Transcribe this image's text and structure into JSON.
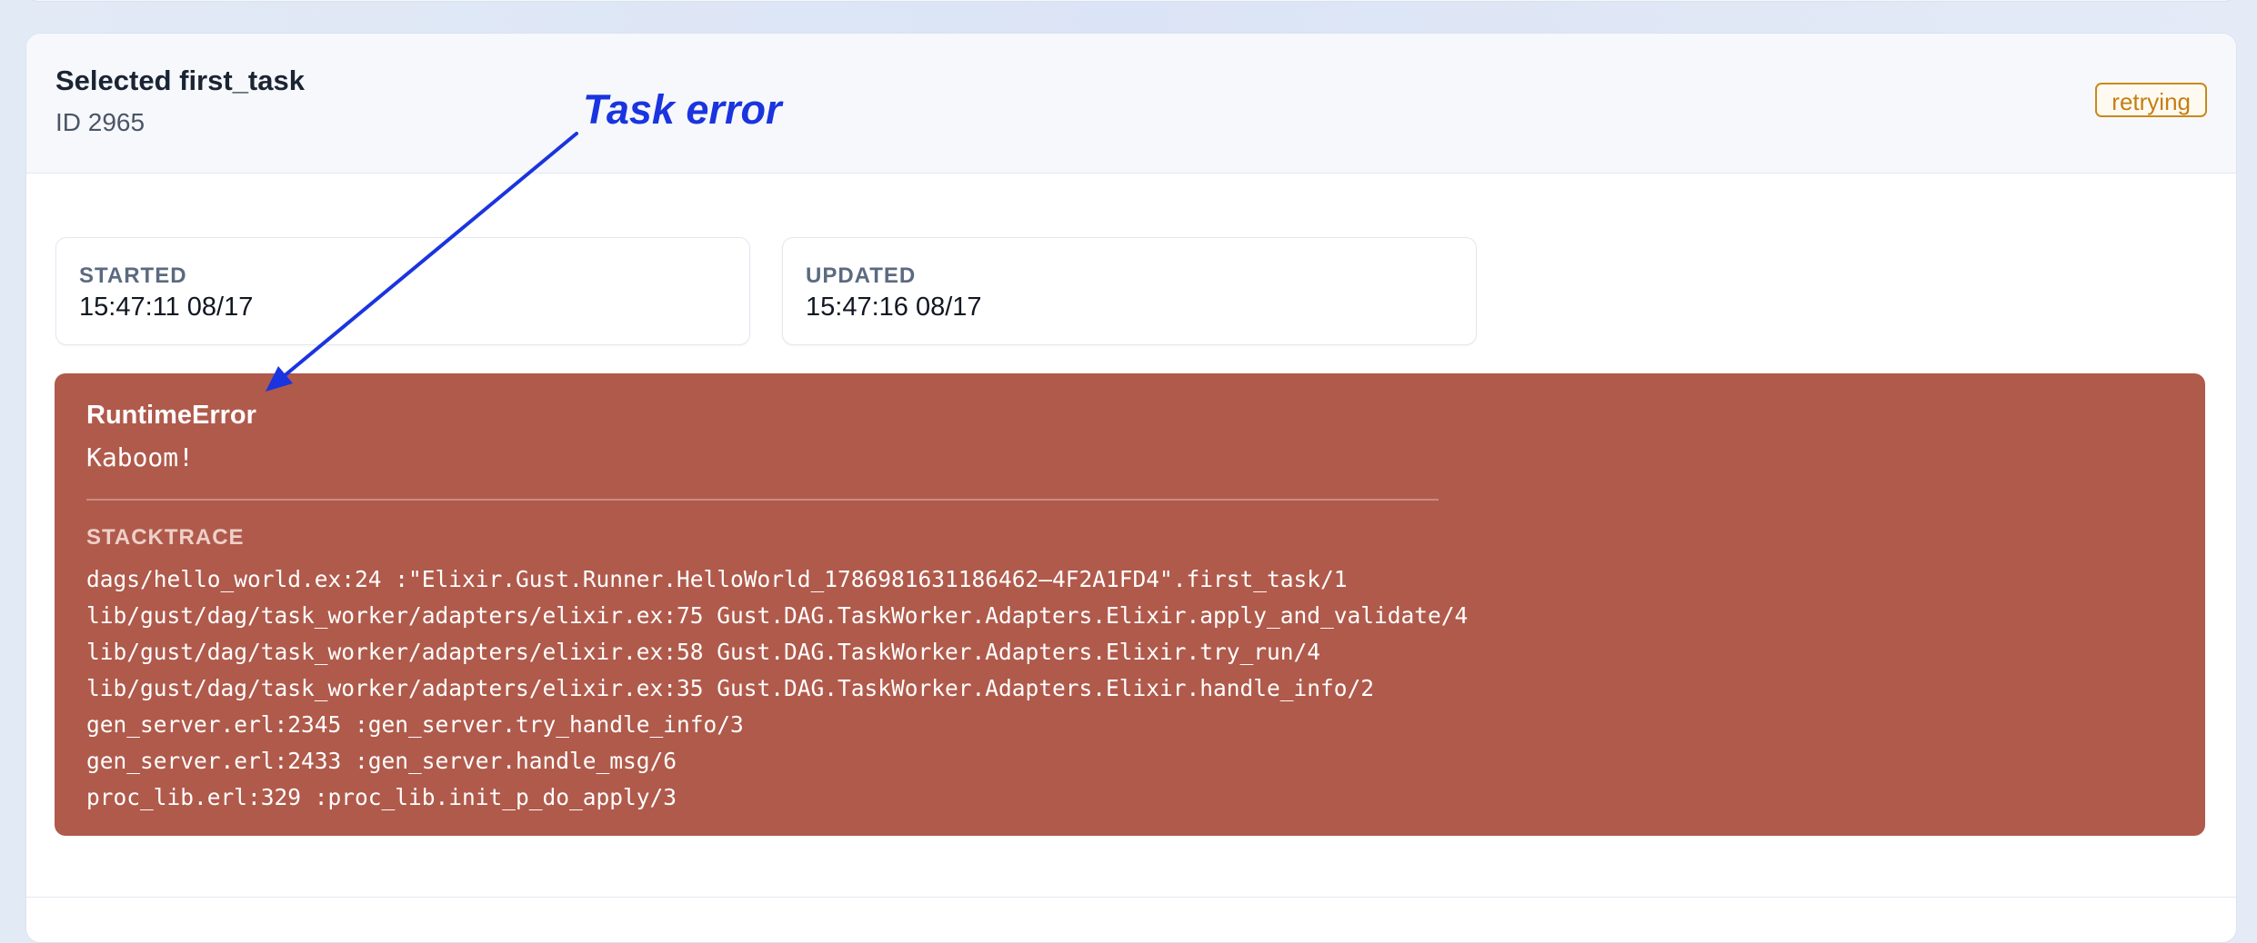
{
  "task": {
    "title": "Selected first_task",
    "id_label": "ID 2965",
    "status": "retrying"
  },
  "annotation": {
    "text": "Task error",
    "color": "#1a34e0"
  },
  "times": {
    "started_label": "STARTED",
    "started_value": "15:47:11 08/17",
    "updated_label": "UPDATED",
    "updated_value": "15:47:16 08/17"
  },
  "error": {
    "type": "RuntimeError",
    "message": "Kaboom!",
    "stacktrace_label": "STACKTRACE",
    "stacktrace": [
      "dags/hello_world.ex:24 :\"Elixir.Gust.Runner.HelloWorld_1786981631186462–4F2A1FD4\".first_task/1",
      "lib/gust/dag/task_worker/adapters/elixir.ex:75 Gust.DAG.TaskWorker.Adapters.Elixir.apply_and_validate/4",
      "lib/gust/dag/task_worker/adapters/elixir.ex:58 Gust.DAG.TaskWorker.Adapters.Elixir.try_run/4",
      "lib/gust/dag/task_worker/adapters/elixir.ex:35 Gust.DAG.TaskWorker.Adapters.Elixir.handle_info/2",
      "gen_server.erl:2345 :gen_server.try_handle_info/3",
      "gen_server.erl:2433 :gen_server.handle_msg/6",
      "proc_lib.erl:329 :proc_lib.init_p_do_apply/3"
    ],
    "background_color": "#b05a4b"
  },
  "colors": {
    "status_accent": "#c47f12"
  }
}
